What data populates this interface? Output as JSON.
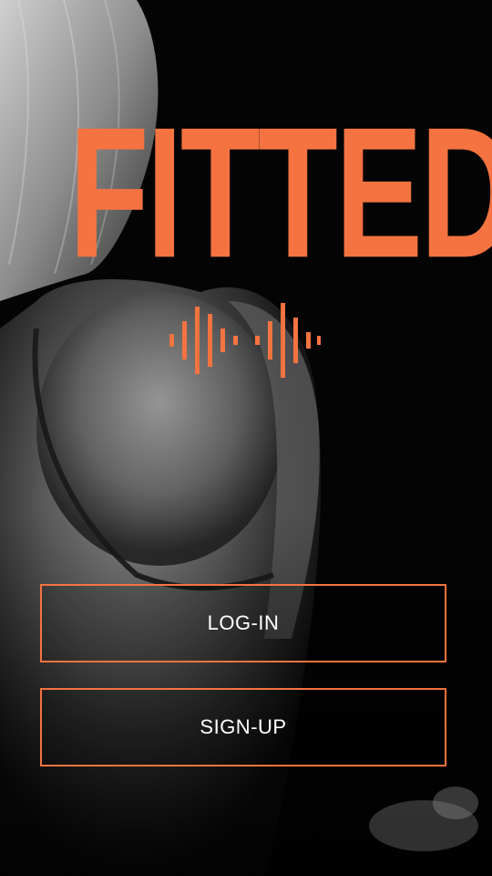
{
  "brand": {
    "name": "FITTED",
    "accent_color": "#f47340",
    "logo_icon": "sound-wave-icon"
  },
  "actions": {
    "login_label": "LOG-IN",
    "signup_label": "SIGN-UP"
  },
  "background": {
    "image": "monochrome photo of athlete's back and shoulder with hair"
  }
}
